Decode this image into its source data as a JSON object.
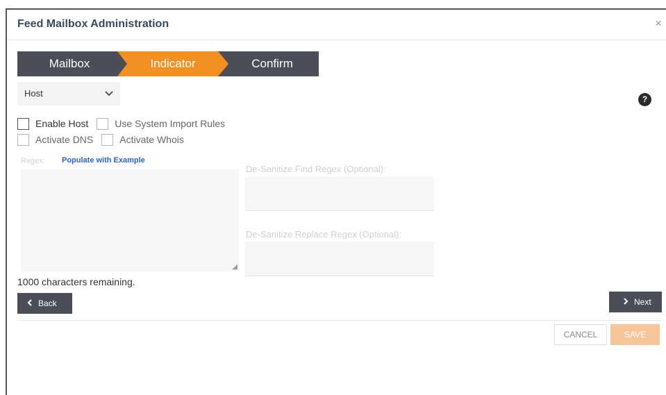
{
  "dialog": {
    "title": "Feed Mailbox Administration",
    "close_icon": "close-icon",
    "close_glyph": "×"
  },
  "steps": [
    {
      "label": "Mailbox",
      "active": false
    },
    {
      "label": "Indicator",
      "active": true
    },
    {
      "label": "Confirm",
      "active": false
    }
  ],
  "indicator_select": {
    "value": "Host",
    "icon": "chevron-down-icon"
  },
  "help": {
    "icon": "help-icon",
    "glyph": "?"
  },
  "checkboxes": [
    {
      "label": "Enable Host",
      "checked": false
    },
    {
      "label": "Use System Import Rules",
      "checked": false
    },
    {
      "label": "Activate DNS",
      "checked": false
    },
    {
      "label": "Activate Whois",
      "checked": false
    }
  ],
  "regex": {
    "label": "Regex:",
    "populate_link": "Populate with Example",
    "value": ""
  },
  "desanitize_find": {
    "label": "De-Sanitize Find Regex (Optional):",
    "value": ""
  },
  "desanitize_replace": {
    "label": "De-Sanitize Replace Regex (Optional):",
    "value": ""
  },
  "chars_remaining": "1000 characters remaining.",
  "nav": {
    "back_label": "Back",
    "next_label": "Next"
  },
  "footer": {
    "cancel_label": "CANCEL",
    "save_label": "SAVE"
  },
  "colors": {
    "accent": "#f29121",
    "step_bg": "#4b4e56",
    "link": "#2b63c6",
    "save_disabled": "#f8c49a"
  }
}
